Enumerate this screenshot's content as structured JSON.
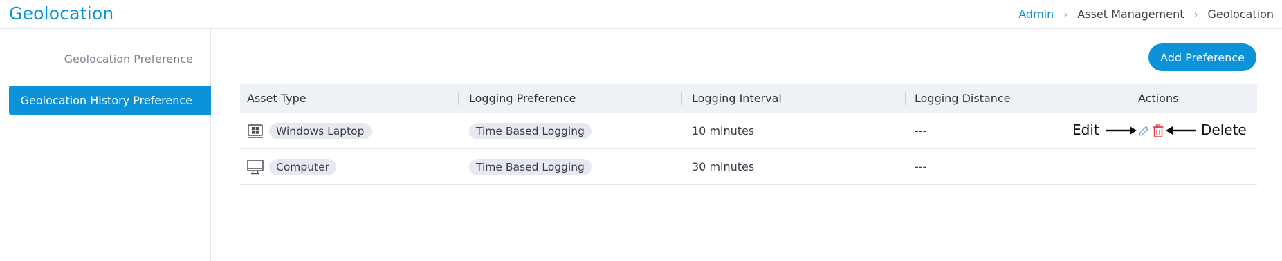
{
  "header": {
    "title": "Geolocation",
    "breadcrumb": [
      "Admin",
      "Asset Management",
      "Geolocation"
    ]
  },
  "sidebar": {
    "items": [
      {
        "label": "Geolocation Preference",
        "active": false
      },
      {
        "label": "Geolocation History Preference",
        "active": true
      }
    ]
  },
  "toolbar": {
    "add_label": "Add Preference"
  },
  "table": {
    "columns": [
      "Asset Type",
      "Logging Preference",
      "Logging Interval",
      "Logging Distance",
      "Actions"
    ],
    "rows": [
      {
        "asset_icon": "windows-laptop-icon",
        "asset_type": "Windows Laptop",
        "logging_preference": "Time Based Logging",
        "logging_interval": "10 minutes",
        "logging_distance": "---"
      },
      {
        "asset_icon": "computer-monitor-icon",
        "asset_type": "Computer",
        "logging_preference": "Time Based Logging",
        "logging_interval": "30 minutes",
        "logging_distance": "---"
      }
    ]
  },
  "annotations": {
    "edit": "Edit",
    "delete": "Delete"
  },
  "colors": {
    "accent": "#0b92d9",
    "delete": "#e0424e",
    "edit": "#8aa7c4"
  }
}
